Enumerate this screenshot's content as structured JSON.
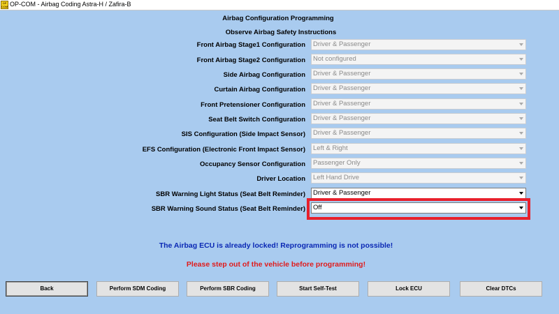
{
  "window": {
    "icon_text": "OP COM",
    "title": "OP-COM - Airbag Coding Astra-H / Zafira-B"
  },
  "header": {
    "title": "Airbag Configuration Programming",
    "subtitle": "Observe Airbag Safety Instructions"
  },
  "config_rows": [
    {
      "label": "Front Airbag Stage1 Configuration",
      "value": "Driver & Passenger",
      "enabled": false
    },
    {
      "label": "Front Airbag Stage2 Configuration",
      "value": "Not configured",
      "enabled": false
    },
    {
      "label": "Side Airbag Configuration",
      "value": "Driver & Passenger",
      "enabled": false
    },
    {
      "label": "Curtain Airbag Configuration",
      "value": "Driver & Passenger",
      "enabled": false
    },
    {
      "label": "Front Pretensioner Configuration",
      "value": "Driver & Passenger",
      "enabled": false
    },
    {
      "label": "Seat Belt Switch Configuration",
      "value": "Driver & Passenger",
      "enabled": false
    },
    {
      "label": "SIS Configuration (Side Impact Sensor)",
      "value": "Driver & Passenger",
      "enabled": false
    },
    {
      "label": "EFS Configuration (Electronic Front Impact Sensor)",
      "value": "Left & Right",
      "enabled": false
    },
    {
      "label": "Occupancy Sensor Configuration",
      "value": "Passenger Only",
      "enabled": false
    },
    {
      "label": "Driver Location",
      "value": "Left Hand Drive",
      "enabled": false
    },
    {
      "label": "SBR Warning Light Status (Seat Belt Reminder)",
      "value": "Driver & Passenger",
      "enabled": true
    },
    {
      "label": "SBR Warning Sound Status (Seat Belt Reminder)",
      "value": "Off",
      "enabled": true
    }
  ],
  "messages": {
    "locked": "The Airbag ECU is already locked! Reprogramming is not possible!",
    "warning": "Please step out of the vehicle before programming!"
  },
  "buttons": {
    "back": "Back",
    "sdm_coding": "Perform SDM Coding",
    "sbr_coding": "Perform SBR Coding",
    "self_test": "Start Self-Test",
    "lock_ecu": "Lock ECU",
    "clear_dtcs": "Clear DTCs"
  },
  "colors": {
    "background": "#a9cbef",
    "highlight": "#e8202c",
    "locked_message": "#0a28b4",
    "warning_message": "#e01b1b"
  }
}
